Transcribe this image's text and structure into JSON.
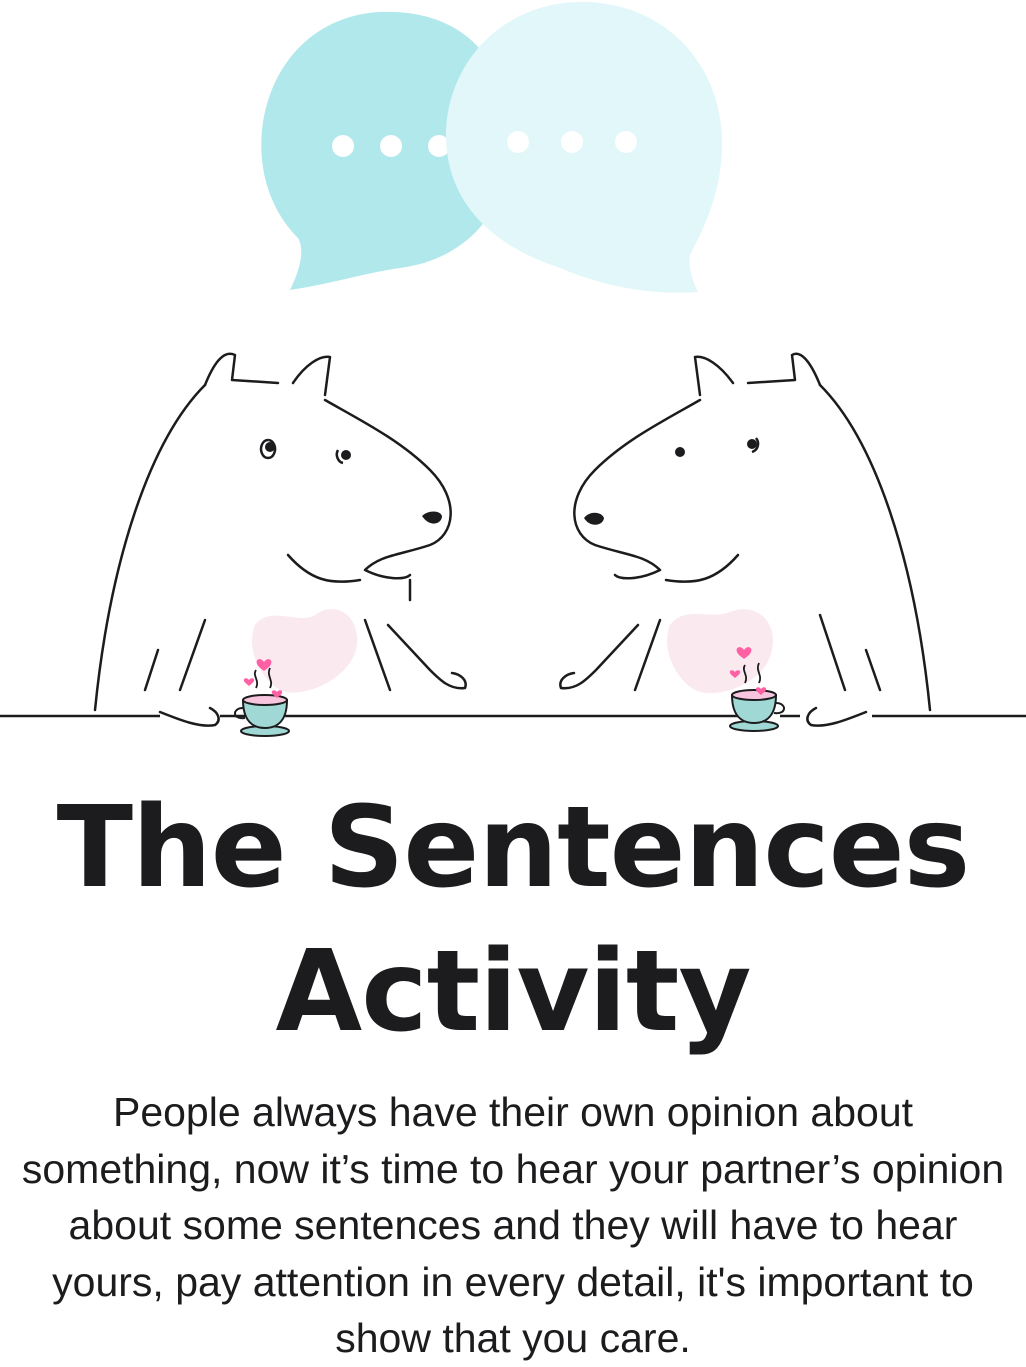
{
  "title_line_1": "The Sentences",
  "title_line_2": "Activity",
  "description": "People always have their own opinion about something, now it’s time to hear your partner’s opinion about some sentences and they will have to hear yours, pay attention in every detail, it's important to show that you care.",
  "colors": {
    "bubble_left": "#b0e8ec",
    "bubble_right": "#e2f7f9",
    "line": "#1c1c1e",
    "heart_blush": "#fbe9f0",
    "hearts": "#ff5fa3",
    "cup": "#9fd8d4"
  }
}
